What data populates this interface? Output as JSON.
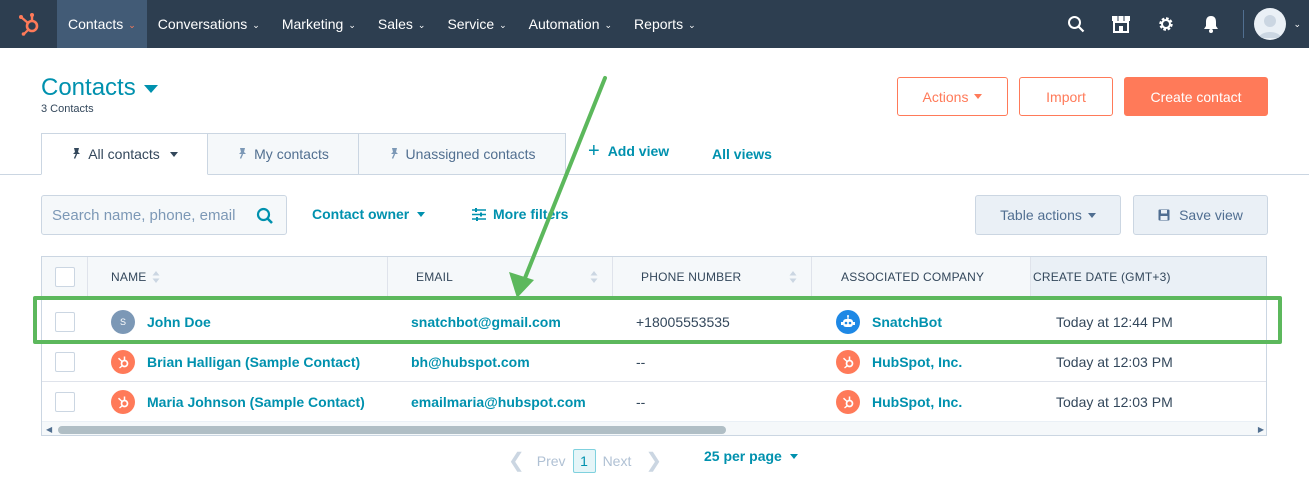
{
  "nav": {
    "items": [
      {
        "label": "Contacts"
      },
      {
        "label": "Conversations"
      },
      {
        "label": "Marketing"
      },
      {
        "label": "Sales"
      },
      {
        "label": "Service"
      },
      {
        "label": "Automation"
      },
      {
        "label": "Reports"
      }
    ],
    "active": "Contacts",
    "accent": "#ff7a59"
  },
  "header": {
    "title": "Contacts",
    "subtitle": "3 Contacts",
    "actions_label": "Actions",
    "import_label": "Import",
    "create_label": "Create contact"
  },
  "tabs": [
    {
      "label": "All contacts"
    },
    {
      "label": "My contacts"
    },
    {
      "label": "Unassigned contacts"
    }
  ],
  "views": {
    "add_view": "Add view",
    "all_views": "All views"
  },
  "filters": {
    "search_placeholder": "Search name, phone, email",
    "contact_owner": "Contact owner",
    "more_filters": "More filters",
    "table_actions": "Table actions",
    "save_view": "Save view"
  },
  "table": {
    "columns": [
      "NAME",
      "EMAIL",
      "PHONE NUMBER",
      "ASSOCIATED COMPANY",
      "CREATE DATE (GMT+3)"
    ],
    "rows": [
      {
        "initial": "S",
        "name": "John Doe",
        "email": "snatchbot@gmail.com",
        "phone": "+18005553535",
        "company": "SnatchBot",
        "company_icon": "robot-icon",
        "date": "Today at 12:44 PM"
      },
      {
        "initial": "",
        "name": "Brian Halligan (Sample Contact)",
        "email": "bh@hubspot.com",
        "phone": "--",
        "company": "HubSpot, Inc.",
        "company_icon": "hubspot-logo-icon",
        "date": "Today at 12:03 PM"
      },
      {
        "initial": "",
        "name": "Maria Johnson (Sample Contact)",
        "email": "emailmaria@hubspot.com",
        "phone": "--",
        "company": "HubSpot, Inc.",
        "company_icon": "hubspot-logo-icon",
        "date": "Today at 12:03 PM"
      }
    ]
  },
  "pagination": {
    "prev": "Prev",
    "page": "1",
    "next": "Next",
    "per_page": "25 per page"
  },
  "colors": {
    "nav_bg": "#2d3e50",
    "link": "#0091ae",
    "primary": "#ff7a59",
    "highlight": "#5cb85c"
  }
}
